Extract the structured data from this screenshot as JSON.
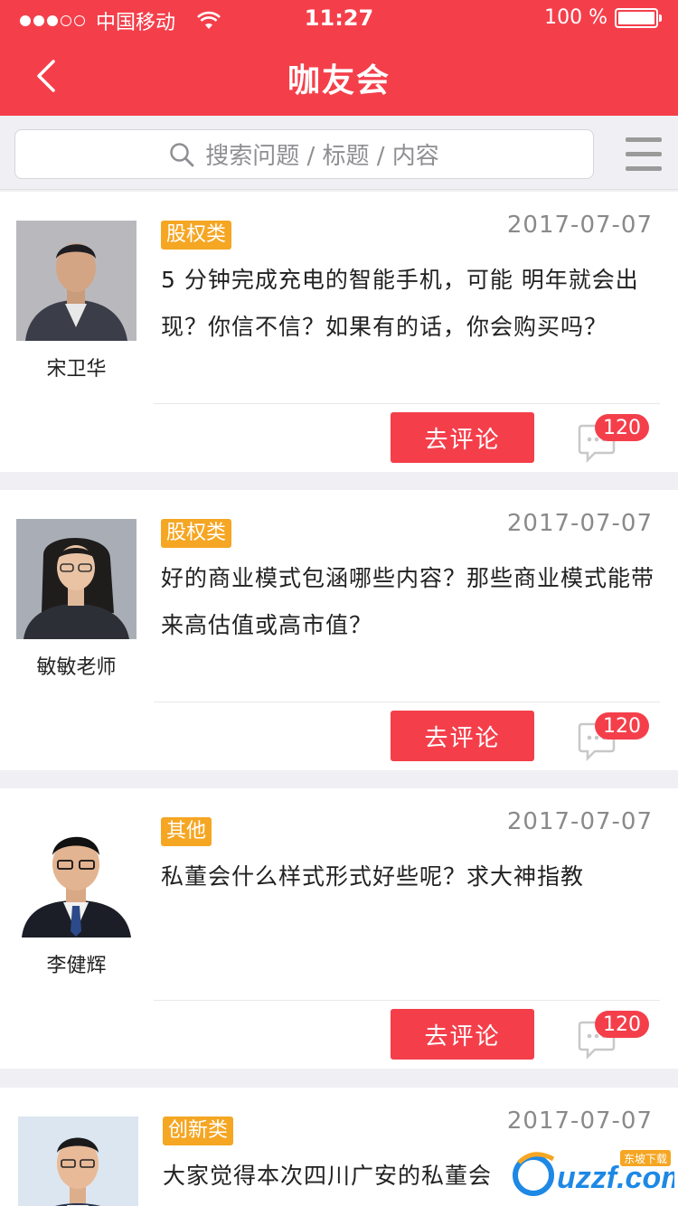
{
  "status_bar": {
    "carrier": "中国移动",
    "time": "11:27",
    "battery": "100 %"
  },
  "nav": {
    "title": "咖友会"
  },
  "search": {
    "placeholder": "搜索问题 / 标题 / 内容"
  },
  "posts": [
    {
      "author": "宋卫华",
      "tag": "股权类",
      "date": "2017-07-07",
      "question": "5 分钟完成充电的智能手机，可能 明年就会出现？你信不信？如果有的话，你会购买吗？",
      "comment_button": "去评论",
      "comment_count": "120"
    },
    {
      "author": "敏敏老师",
      "tag": "股权类",
      "date": "2017-07-07",
      "question": "好的商业模式包涵哪些内容？那些商业模式能带来高估值或高市值？",
      "comment_button": "去评论",
      "comment_count": "120"
    },
    {
      "author": "李健辉",
      "tag": "其他",
      "date": "2017-07-07",
      "question": "私董会什么样式形式好些呢？求大神指教",
      "comment_button": "去评论",
      "comment_count": "120"
    },
    {
      "author": "",
      "tag": "创新类",
      "date": "2017-07-07",
      "question": "大家觉得本次四川广安的私董会",
      "comment_button": "",
      "comment_count": ""
    }
  ],
  "watermark": {
    "text": "uzzf.com",
    "sub": "东坡下载"
  },
  "colors": {
    "brand_red": "#f43f4b",
    "tag_orange": "#f5a623",
    "background": "#efeff4"
  }
}
